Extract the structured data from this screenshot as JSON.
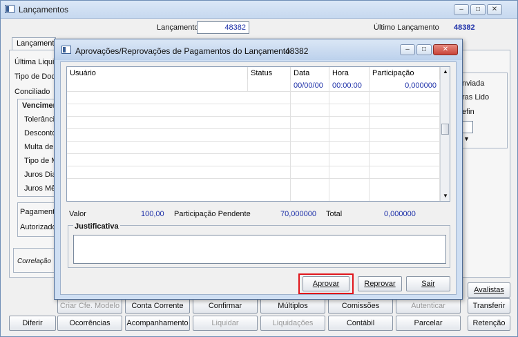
{
  "window": {
    "title": "Lançamentos",
    "lancamento_label": "Lançamento",
    "lancamento_value": "48382",
    "ultimo_label": "Último Lançamento",
    "ultimo_value": "48382"
  },
  "tabs": [
    "Lançamento"
  ],
  "side_labels": {
    "ultima": "Última Liquid",
    "tipo_doc": "Tipo de Docu",
    "conciliado": "Conciliado",
    "vencimento": "Vencimen",
    "tolerancia": "Tolerância",
    "desconto": "Desconto",
    "multa": "Multa de",
    "tipo_mo": "Tipo de M",
    "juros_dia": "Juros Dia",
    "juros_mes": "Juros Mês",
    "pagamento": "Pagamento",
    "autorizado": "Autorizado",
    "correlacao": "Correlação"
  },
  "right_labels": {
    "enviada": "nviada",
    "lido": "ras Lido",
    "efin": "efin"
  },
  "dialog": {
    "title": "Aprovações/Reprovações de Pagamentos do Lançamento",
    "title_number": "48382",
    "columns": [
      "Usuário",
      "Status",
      "Data",
      "Hora",
      "Participação"
    ],
    "rows": [
      {
        "usuario": "",
        "status": "",
        "data": "00/00/00",
        "hora": "00:00:00",
        "participacao": "0,000000"
      }
    ],
    "valor_label": "Valor",
    "valor_value": "100,00",
    "pendente_label": "Participação Pendente",
    "pendente_value": "70,000000",
    "total_label": "Total",
    "total_value": "0,000000",
    "justificativa_label": "Justificativa",
    "justificativa_value": "",
    "buttons": {
      "aprovar": "Aprovar",
      "reprovar": "Reprovar",
      "sair": "Sair"
    }
  },
  "bottom_buttons": {
    "row1": {
      "criar": "Criar Cfe. Modelo",
      "conta": "Conta Corrente",
      "confirmar": "Confirmar",
      "multiplos": "Múltiplos",
      "comissoes": "Comissões",
      "autenticar": "Autenticar",
      "transferir": "Transferir",
      "avalistas": "Avalistas"
    },
    "row2": {
      "diferir": "Diferir",
      "ocorrencias": "Ocorrências",
      "acompanhamento": "Acompanhamento",
      "liquidar": "Liquidar",
      "liquidacoes": "Liquidações",
      "contabil": "Contábil",
      "parcelar": "Parcelar",
      "retencao": "Retenção"
    }
  },
  "colors": {
    "value_blue": "#1c2fa8",
    "highlight_red": "#e0151b",
    "close_red": "#c9443a"
  }
}
